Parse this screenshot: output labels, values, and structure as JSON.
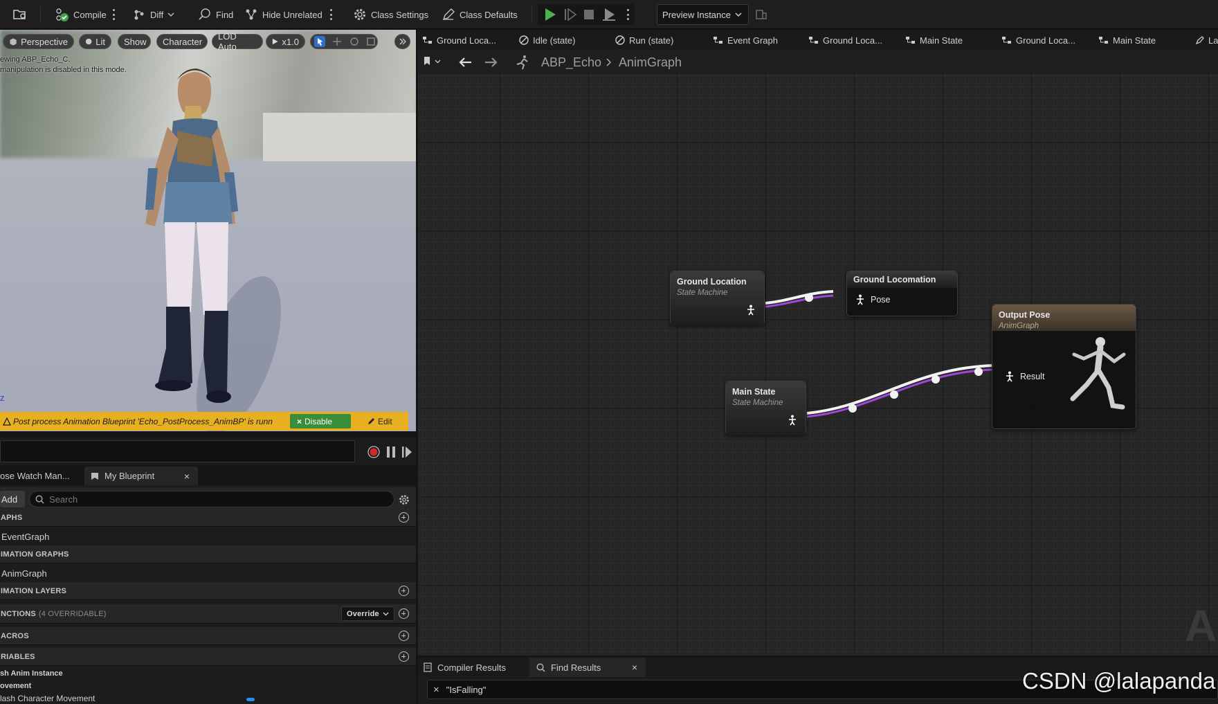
{
  "toolbar": {
    "compile": "Compile",
    "diff": "Diff",
    "find": "Find",
    "hide_unrelated": "Hide Unrelated",
    "class_settings": "Class Settings",
    "class_defaults": "Class Defaults",
    "preview_instance": "Preview Instance"
  },
  "viewport": {
    "perspective": "Perspective",
    "lit": "Lit",
    "show": "Show",
    "character": "Character",
    "lod": "LOD Auto",
    "speed": "x1.0",
    "info_line1": "ewing ABP_Echo_C.",
    "info_line2": "manipulation is disabled in this mode.",
    "axis_label": "z",
    "warning_text": "Post process Animation Blueprint 'Echo_PostProcess_AnimBP' is runn",
    "disable_label": "Disable",
    "edit_label": "Edit"
  },
  "bp_panel": {
    "tab_pose_watch": "ose Watch Man...",
    "tab_my_blueprint": "My Blueprint",
    "add_label": "Add",
    "search_placeholder": "Search",
    "sections": {
      "graphs": "APHS",
      "event_graph": "EventGraph",
      "animation_graphs": "IMATION GRAPHS",
      "anim_graph": "AnimGraph",
      "animation_layers": "IMATION LAYERS",
      "functions": "NCTIONS",
      "functions_count": "(4 OVERRIDABLE)",
      "override": "Override",
      "macros": "ACROS",
      "variables": "RIABLES",
      "var_cat1": "sh Anim Instance",
      "var_cat2": "ovement",
      "var_item": "lash Character Movement"
    }
  },
  "doc_tabs": [
    "Ground Loca...",
    "Idle (state)",
    "Run (state)",
    "Event Graph",
    "Ground Loca...",
    "Main State",
    "Ground Loca...",
    "Main State",
    "La"
  ],
  "breadcrumb": {
    "root": "ABP_Echo",
    "current": "AnimGraph"
  },
  "graph": {
    "watermark": "AN",
    "nodes": {
      "ground_location_sm": {
        "title": "Ground Location",
        "subtitle": "State Machine"
      },
      "ground_locomation": {
        "title": "Ground Locomation",
        "pin": "Pose"
      },
      "main_state_sm": {
        "title": "Main State",
        "subtitle": "State Machine"
      },
      "output_pose": {
        "title": "Output Pose",
        "subtitle": "AnimGraph",
        "pin": "Result"
      }
    }
  },
  "bottom": {
    "compiler_results": "Compiler Results",
    "find_results": "Find Results",
    "find_query": "\"IsFalling\""
  },
  "watermark_credit": "CSDN @lalapanda",
  "colors": {
    "accent_green": "#4caf50",
    "warning_yellow": "#e8b021",
    "wire_purple": "#a046d8",
    "disable_green": "#3a8e3a",
    "output_pose_head": "#6b5a45"
  }
}
